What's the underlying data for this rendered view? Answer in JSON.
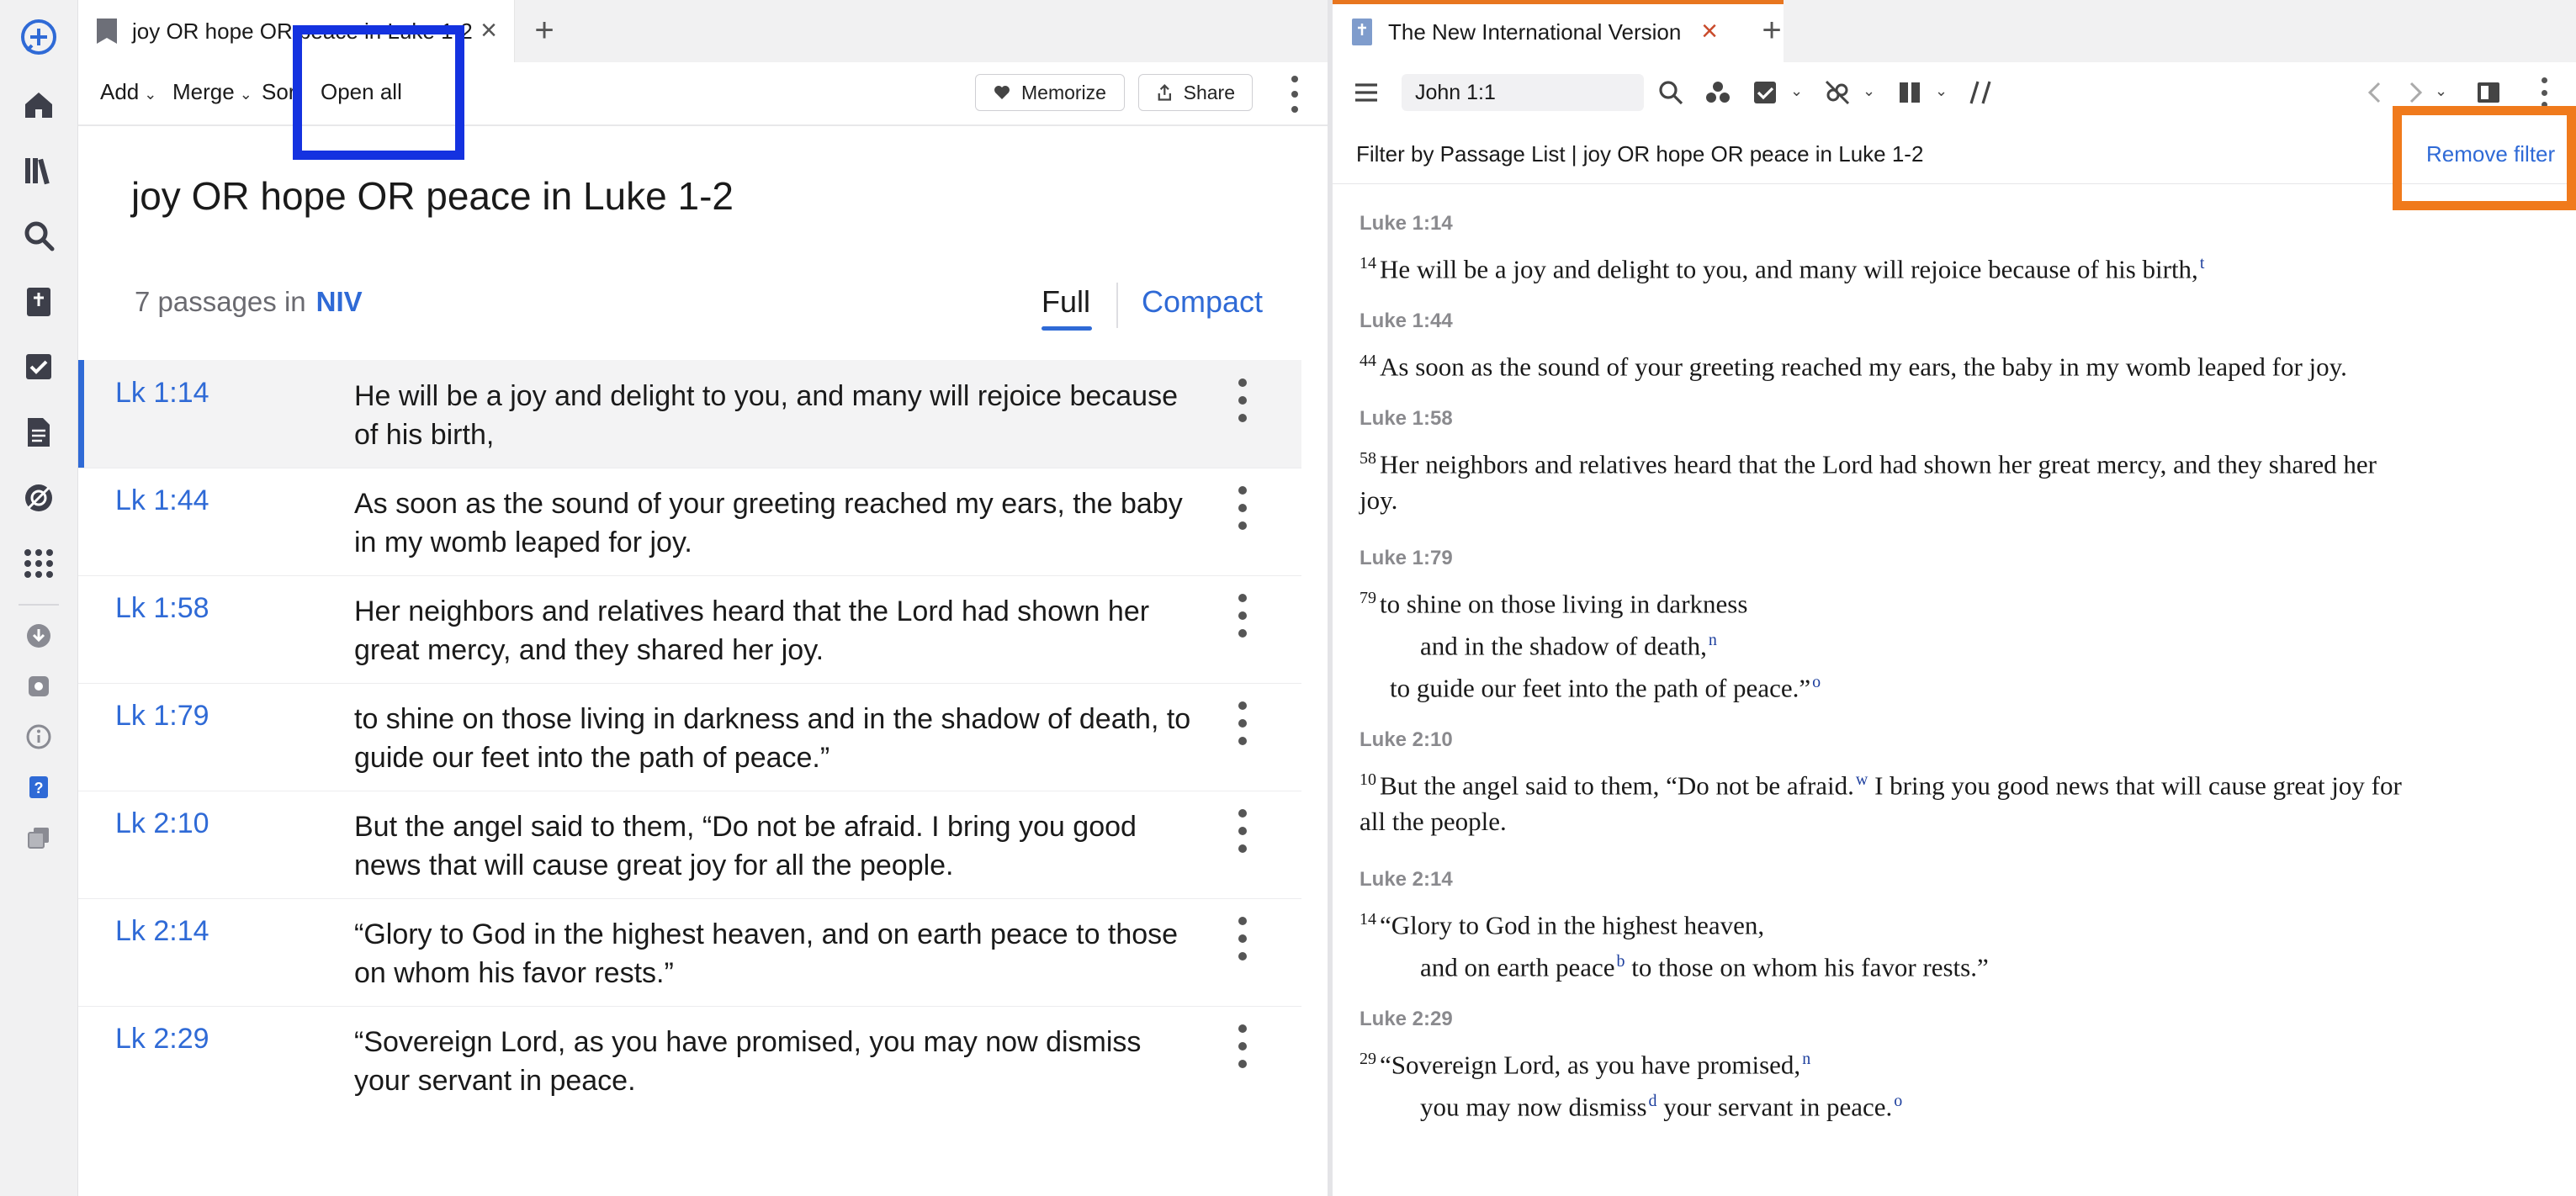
{
  "left_tab": {
    "title": "joy OR hope OR peace in Luke 1-2"
  },
  "left_toolbar": {
    "add_label": "Add",
    "merge_label": "Merge",
    "sort_label": "Sort",
    "open_all_label": "Open all",
    "memorize_label": "Memorize",
    "share_label": "Share"
  },
  "passage_list": {
    "title": "joy OR hope OR peace in Luke 1-2",
    "count_text": "7 passages in",
    "version": "NIV",
    "view_full": "Full",
    "view_compact": "Compact",
    "rows": [
      {
        "ref": "Lk 1:14",
        "text": "He will be a joy and delight to you, and many will rejoice because of his birth,"
      },
      {
        "ref": "Lk 1:44",
        "text": "As soon as the sound of your greeting reached my ears, the baby in my womb leaped for joy."
      },
      {
        "ref": "Lk 1:58",
        "text": "Her neighbors and relatives heard that the Lord had shown her great mercy, and they shared her joy."
      },
      {
        "ref": "Lk 1:79",
        "text": "to shine on those living in darkness and in the shadow of death, to guide our feet into the path of peace.”"
      },
      {
        "ref": "Lk 2:10",
        "text": "But the angel said to them, “Do not be afraid. I bring you good news that will cause great joy for all the people."
      },
      {
        "ref": "Lk 2:14",
        "text": "“Glory to God in the highest heaven, and on earth peace to those on whom his favor rests.”"
      },
      {
        "ref": "Lk 2:29",
        "text": "“Sovereign Lord, as you have promised, you may now dismiss your servant in peace."
      }
    ]
  },
  "right_tab": {
    "title": "The New International Version"
  },
  "right_toolbar": {
    "reference_value": "John 1:1"
  },
  "filter_bar": {
    "text": "Filter by Passage List | joy OR hope OR peace in Luke 1-2",
    "remove_label": "Remove filter"
  },
  "bible": {
    "v1": {
      "head": "Luke 1:14",
      "num": "14",
      "text": "He will be a joy and delight to you, and many will rejoice because of his birth,",
      "fn": "t"
    },
    "v2": {
      "head": "Luke 1:44",
      "num": "44",
      "text": "As soon as the sound of your greeting reached my ears, the baby in my womb leaped for joy."
    },
    "v3": {
      "head": "Luke 1:58",
      "num": "58",
      "text1": "Her neighbors and relatives heard that the Lord had shown her great mercy, and they shared her",
      "text2": "joy."
    },
    "v4": {
      "head": "Luke 1:79",
      "num": "79",
      "line1": "to shine on those living in darkness",
      "line2": "and in the shadow of death,",
      "fn2": "n",
      "line3": "to guide our feet into the path of peace.”",
      "fn3": "o"
    },
    "v5": {
      "head": "Luke 2:10",
      "num": "10",
      "text1a": "But the angel said to them, “Do not be afraid.",
      "fn": "w",
      "text1b": "I bring you good news that will cause great joy for",
      "text2": "all the people."
    },
    "v6": {
      "head": "Luke 2:14",
      "num": "14",
      "line1": "“Glory to God in the highest heaven,",
      "line2a": "and on earth peace",
      "fn": "b",
      "line2b": "to those on whom his favor rests.”"
    },
    "v7": {
      "head": "Luke 2:29",
      "num": "29",
      "line1": "“Sovereign Lord, as you have promised,",
      "fn1": "n",
      "line2a": "you may now dismiss",
      "fn2": "d",
      "line2b": "your servant in peace.",
      "fn3": "o"
    }
  },
  "colors": {
    "accent": "#2f6ad6",
    "highlight_blue": "#1432e0",
    "highlight_orange": "#f07a1c",
    "tab_active": "#e8761f"
  },
  "icons": [
    "logo-icon",
    "home-icon",
    "library-icon",
    "search-icon",
    "bible-book-icon",
    "checklist-icon",
    "document-icon",
    "atlas-icon",
    "apps-icon",
    "download-icon",
    "settings-icon",
    "info-icon",
    "help-icon",
    "layers-icon"
  ]
}
